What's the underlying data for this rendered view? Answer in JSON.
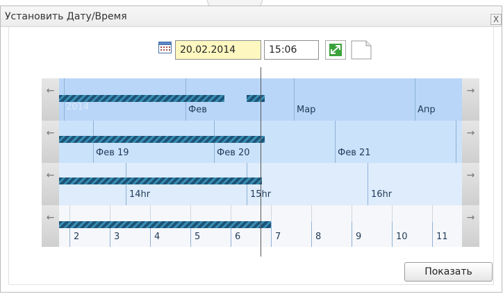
{
  "dialog": {
    "title": "Установить Дату/Время",
    "close_glyph": "X"
  },
  "controls": {
    "date_value": "20.02.2014",
    "time_value": "15:06",
    "calendar_icon": "calendar-icon",
    "expand_icon": "expand-arrows-icon",
    "page_icon": "blank-page-icon"
  },
  "timeline": {
    "nav_left_glyph": "←",
    "nav_right_glyph": "→",
    "months_band": {
      "year_label": "2014",
      "labels": [
        "Фев",
        "Мар",
        "Апр"
      ]
    },
    "days_band": {
      "labels": [
        "Фев 19",
        "Фев 20",
        "Фев 21"
      ]
    },
    "hours_band": {
      "labels": [
        "14hr",
        "15hr",
        "16hr"
      ]
    },
    "minutes_band": {
      "labels": [
        "2",
        "3",
        "4",
        "5",
        "6",
        "7",
        "8",
        "9",
        "10",
        "11"
      ]
    }
  },
  "footer": {
    "show_button_label": "Показать"
  },
  "colors": {
    "band1": "#b9d6f8",
    "band2": "#cbe2fb",
    "band3": "#deecfc",
    "band4": "#f6f7fa",
    "date_field_bg": "#fff7c0",
    "bar_dark": "#1d5477",
    "bar_light": "#3a8fb5"
  }
}
